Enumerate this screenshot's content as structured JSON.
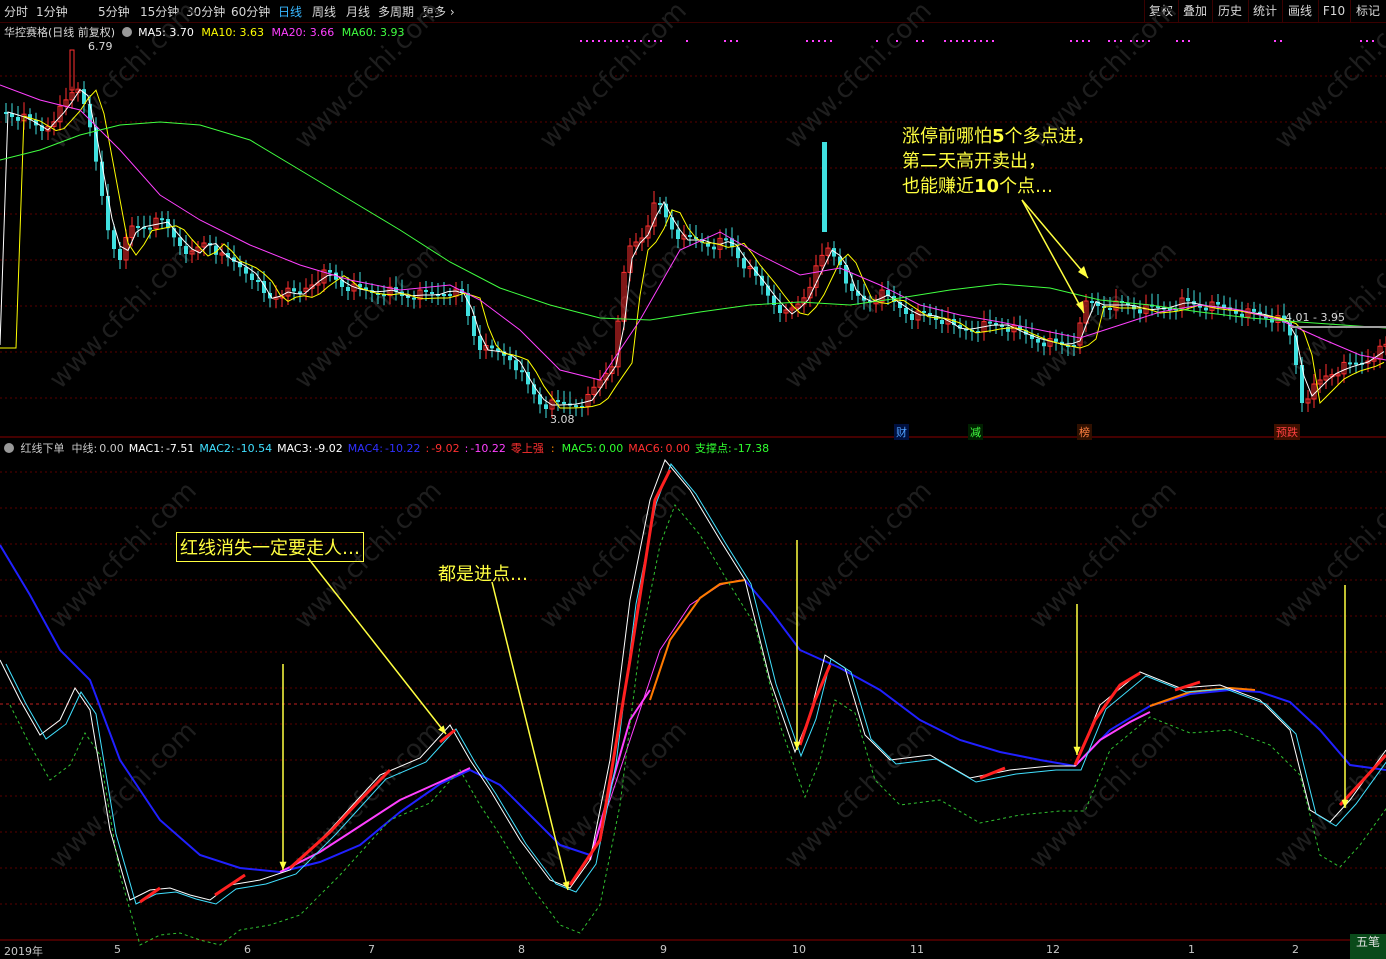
{
  "toolbar": {
    "periods": [
      "分时",
      "1分钟",
      "5分钟",
      "15分钟",
      "30分钟",
      "60分钟",
      "日线",
      "周线",
      "月线",
      "多周期"
    ],
    "active": "日线",
    "more": "更多",
    "right": [
      "复权",
      "叠加",
      "历史",
      "统计",
      "画线",
      "F10",
      "标记"
    ]
  },
  "main_panel": {
    "title": "华控赛格(日线 前复权)",
    "ma": [
      {
        "label": "MA5:",
        "value": "3.70",
        "color": "#ffffff"
      },
      {
        "label": "MA10:",
        "value": "3.63",
        "color": "#ffff00"
      },
      {
        "label": "MA20:",
        "value": "3.66",
        "color": "#ff40ff"
      },
      {
        "label": "MA60:",
        "value": "3.93",
        "color": "#40ff40"
      }
    ],
    "price_high": "6.79",
    "price_low": "3.08",
    "price_range": "4.01 - 3.95",
    "markers": [
      {
        "text": "财",
        "color": "#4fa0ff"
      },
      {
        "text": "减",
        "color": "#40ff40"
      },
      {
        "text": "榜",
        "color": "#ff8040"
      },
      {
        "text": "预跌",
        "color": "#ff4040"
      }
    ],
    "annotation": [
      "涨停前哪怕",
      "5",
      "个多点进，",
      "第二天高开卖出，",
      "也能赚近",
      "10",
      "个点…"
    ]
  },
  "indicator_panel": {
    "items": [
      {
        "label": "红线下单",
        "value": "",
        "color": "#c8c8c8"
      },
      {
        "label": "中线:",
        "value": "0.00",
        "color": "#c8c8c8"
      },
      {
        "label": "MAC1:",
        "value": "-7.51",
        "color": "#ffffff"
      },
      {
        "label": "MAC2:",
        "value": "-10.54",
        "color": "#40e0ff"
      },
      {
        "label": "MAC3:",
        "value": "-9.02",
        "color": "#ffffff"
      },
      {
        "label": "MAC4:",
        "value": "-10.22",
        "color": "#3030ff"
      },
      {
        "label": ":",
        "value": "-9.02",
        "color": "#ff3030"
      },
      {
        "label": ":",
        "value": "-10.22",
        "color": "#ff40ff"
      },
      {
        "label": "零上强",
        "value": "",
        "color": "#ff3030"
      },
      {
        "label": ":",
        "value": "",
        "color": "#ff8c00"
      },
      {
        "label": "MAC5:",
        "value": "0.00",
        "color": "#30ff30"
      },
      {
        "label": "MAC6:",
        "value": "0.00",
        "color": "#ff3030"
      },
      {
        "label": "支撑点:",
        "value": "-17.38",
        "color": "#30ff30"
      }
    ],
    "callout1": "红线消失一定要走人…",
    "callout2": "都是进点…"
  },
  "dates": [
    "2019年",
    "5",
    "6",
    "7",
    "8",
    "9",
    "10",
    "11",
    "12",
    "1",
    "2"
  ],
  "corner_tab": "五笔",
  "watermark": "www.cfchi.com"
}
